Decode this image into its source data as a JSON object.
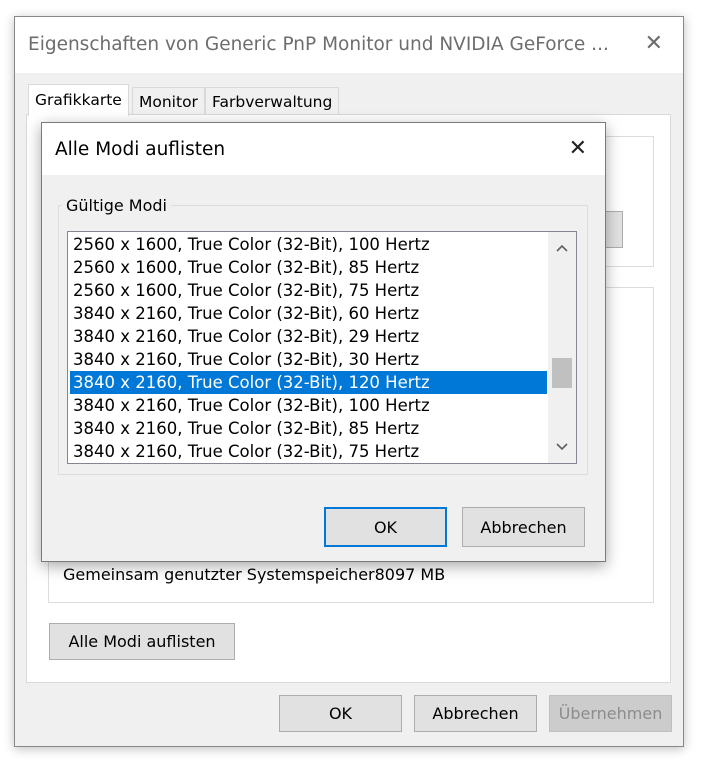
{
  "outer_window": {
    "title": "Eigenschaften von Generic PnP Monitor und NVIDIA GeForce ...",
    "close_glyph": "✕",
    "tabs": [
      {
        "label": "Grafikkarte",
        "active": true
      },
      {
        "label": "Monitor",
        "active": false
      },
      {
        "label": "Farbverwaltung",
        "active": false
      }
    ],
    "shared_memory_label": "Gemeinsam genutzter Systemspeicher",
    "shared_memory_value": "8097 MB",
    "list_all_modes_button": "Alle Modi auflisten",
    "buttons": {
      "ok": "OK",
      "cancel": "Abbrechen",
      "apply": "Übernehmen"
    }
  },
  "modal": {
    "title": "Alle Modi auflisten",
    "close_glyph": "✕",
    "group_label": "Gültige Modi",
    "modes": [
      "2560 x 1600, True Color (32-Bit), 100 Hertz",
      "2560 x 1600, True Color (32-Bit), 85 Hertz",
      "2560 x 1600, True Color (32-Bit), 75 Hertz",
      "3840 x 2160, True Color (32-Bit), 60 Hertz",
      "3840 x 2160, True Color (32-Bit), 29 Hertz",
      "3840 x 2160, True Color (32-Bit), 30 Hertz",
      "3840 x 2160, True Color (32-Bit), 120 Hertz",
      "3840 x 2160, True Color (32-Bit), 100 Hertz",
      "3840 x 2160, True Color (32-Bit), 85 Hertz",
      "3840 x 2160, True Color (32-Bit), 75 Hertz"
    ],
    "selected_index": 6,
    "scroll_position_fraction": 0.85,
    "buttons": {
      "ok": "OK",
      "cancel": "Abbrechen"
    }
  },
  "colors": {
    "selection": "#0078d7",
    "dialog_background": "#f0f0f0",
    "disabled_text": "#8c8c8c"
  }
}
